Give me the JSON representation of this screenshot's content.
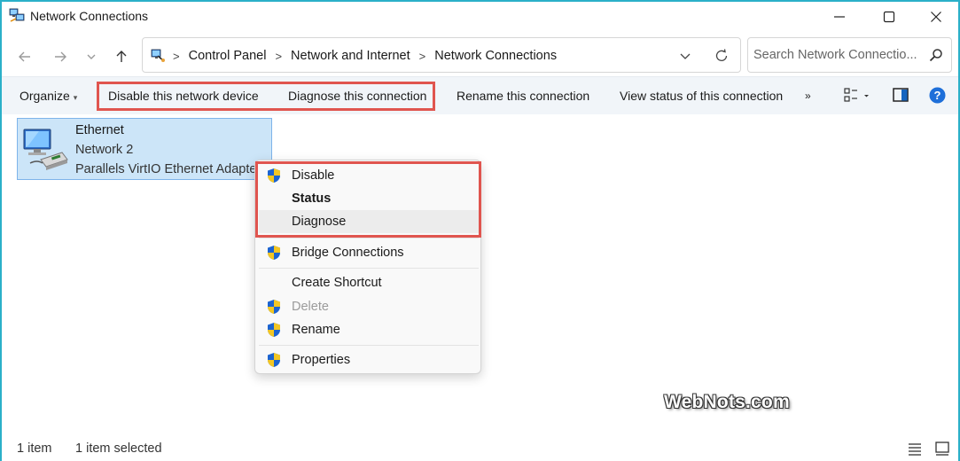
{
  "window": {
    "title": "Network Connections",
    "accent": "#2bb0c8"
  },
  "nav": {
    "breadcrumbs": [
      "Control Panel",
      "Network and Internet",
      "Network Connections"
    ],
    "search_placeholder": "Search Network Connectio..."
  },
  "toolbar": {
    "organize": "Organize",
    "disable": "Disable this network device",
    "diagnose": "Diagnose this connection",
    "rename": "Rename this connection",
    "view_status": "View status of this connection",
    "more": "»",
    "highlight_color": "#e0554f"
  },
  "item": {
    "name": "Ethernet",
    "network": "Network 2",
    "adapter": "Parallels VirtIO Ethernet Adapter"
  },
  "context_menu": {
    "items": [
      {
        "label": "Disable",
        "shield": true
      },
      {
        "label": "Status",
        "bold": true
      },
      {
        "label": "Diagnose",
        "hover": true
      },
      {
        "label": "Bridge Connections",
        "shield": true
      },
      {
        "label": "Create Shortcut"
      },
      {
        "label": "Delete",
        "shield": true,
        "disabled": true
      },
      {
        "label": "Rename",
        "shield": true
      },
      {
        "label": "Properties",
        "shield": true
      }
    ]
  },
  "watermark": "WebNots.com",
  "status": {
    "count": "1 item",
    "selected": "1 item selected"
  }
}
